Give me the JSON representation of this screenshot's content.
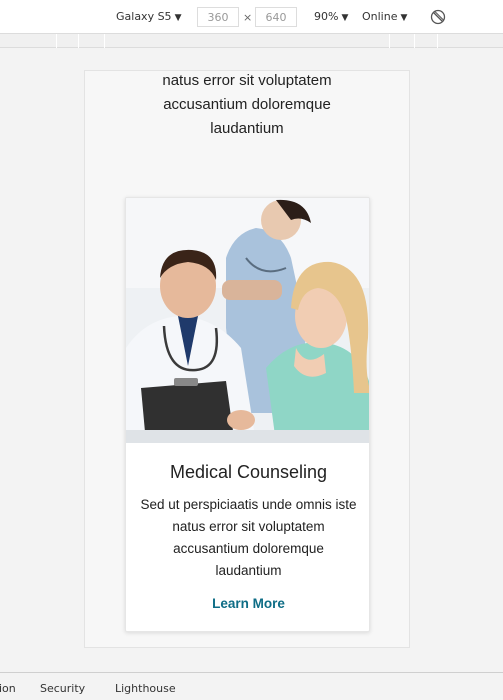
{
  "toolbar": {
    "device": "Galaxy S5",
    "width": "360",
    "height": "640",
    "times_symbol": "×",
    "zoom": "90%",
    "network": "Online",
    "caret": "▼"
  },
  "page": {
    "previous_text": "natus error sit voluptatem accusantium doloremque laudantium",
    "card": {
      "title": "Medical Counseling",
      "description": "Sed ut perspiciaatis unde omnis iste natus error sit voluptatem accusantium doloremque laudantium",
      "link": "Learn More",
      "link_color": "#0e6d86"
    }
  },
  "bottom_tabs": [
    "ion",
    "Security",
    "Lighthouse"
  ],
  "icons": {
    "rotate": "rotate-icon"
  }
}
